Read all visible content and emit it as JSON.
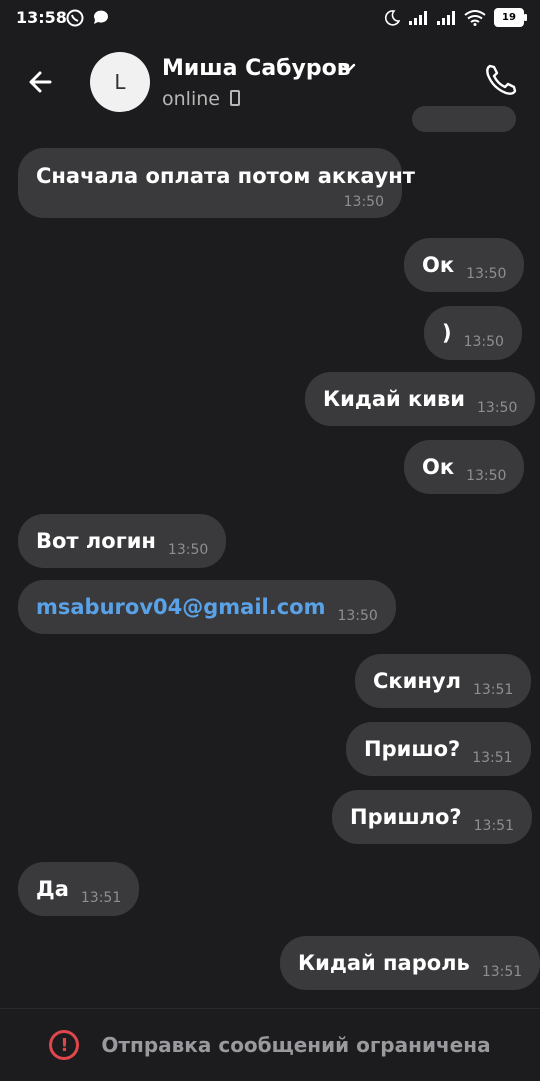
{
  "status_bar": {
    "time": "13:58",
    "battery": "19",
    "left_icons": [
      "whatsapp-icon",
      "chat-icon"
    ],
    "right_icons": [
      "moon-icon",
      "signal-icon",
      "signal-icon",
      "wifi-icon",
      "battery-icon"
    ]
  },
  "header": {
    "contact_name": "Миша Сабуров",
    "status": "online",
    "avatar_glyph": "L",
    "icons": {
      "back": "back-arrow-icon",
      "call": "phone-icon",
      "chevron": "chevron-down-icon",
      "device": "mobile-device-icon"
    }
  },
  "messages": [
    {
      "text": "Сначала оплата потом аккаунт",
      "time": "13:50",
      "side": "left"
    },
    {
      "text": "Ок",
      "time": "13:50",
      "side": "right"
    },
    {
      "text": ")",
      "time": "13:50",
      "side": "right"
    },
    {
      "text": "Кидай киви",
      "time": "13:50",
      "side": "right"
    },
    {
      "text": "Ок",
      "time": "13:50",
      "side": "right"
    },
    {
      "text": "Вот логин",
      "time": "13:50",
      "side": "left"
    },
    {
      "text": "msaburov04@gmail.com",
      "time": "13:50",
      "side": "left",
      "link": true
    },
    {
      "text": "Скинул",
      "time": "13:51",
      "side": "right"
    },
    {
      "text": "Пришо?",
      "time": "13:51",
      "side": "right"
    },
    {
      "text": "Пришло?",
      "time": "13:51",
      "side": "right"
    },
    {
      "text": "Да",
      "time": "13:51",
      "side": "left"
    },
    {
      "text": "Кидай пароль",
      "time": "13:51",
      "side": "right"
    }
  ],
  "bottom_bar": {
    "text": "Отправка сообщений ограничена",
    "icon": "alert-circle-icon",
    "accent_color": "#e0474c"
  },
  "colors": {
    "background": "#1c1c1e",
    "bubble": "#3a3a3c",
    "link": "#5aa2e8"
  }
}
